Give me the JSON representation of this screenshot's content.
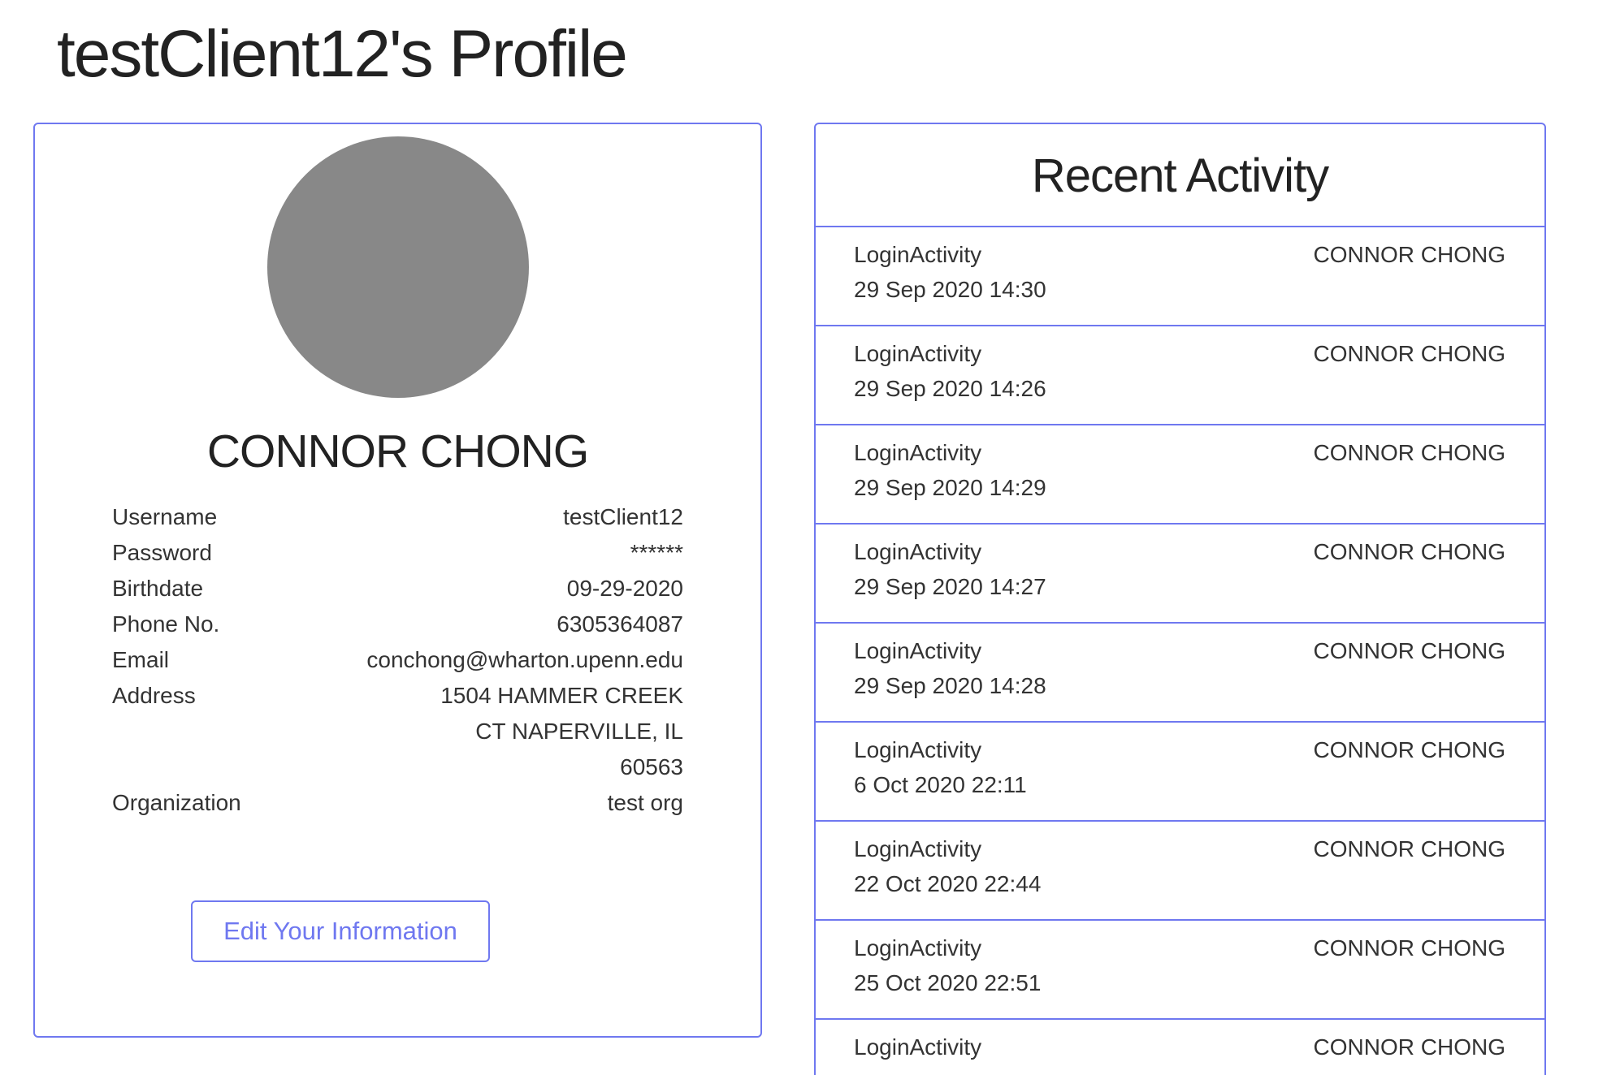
{
  "page": {
    "title": "testClient12's Profile"
  },
  "profile": {
    "name": "CONNOR CHONG",
    "fields": [
      {
        "label": "Username",
        "value": "testClient12"
      },
      {
        "label": "Password",
        "value": "******"
      },
      {
        "label": "Birthdate",
        "value": "09-29-2020"
      },
      {
        "label": "Phone No.",
        "value": "6305364087"
      },
      {
        "label": "Email",
        "value": "conchong@wharton.upenn.edu"
      },
      {
        "label": "Address",
        "value": "1504 HAMMER CREEK CT NAPERVILLE, IL 60563"
      },
      {
        "label": "Organization",
        "value": "test org"
      }
    ],
    "edit_button_label": "Edit Your Information"
  },
  "activity": {
    "title": "Recent Activity",
    "items": [
      {
        "type": "LoginActivity",
        "time": "29 Sep 2020 14:30",
        "user": "CONNOR CHONG"
      },
      {
        "type": "LoginActivity",
        "time": "29 Sep 2020 14:26",
        "user": "CONNOR CHONG"
      },
      {
        "type": "LoginActivity",
        "time": "29 Sep 2020 14:29",
        "user": "CONNOR CHONG"
      },
      {
        "type": "LoginActivity",
        "time": "29 Sep 2020 14:27",
        "user": "CONNOR CHONG"
      },
      {
        "type": "LoginActivity",
        "time": "29 Sep 2020 14:28",
        "user": "CONNOR CHONG"
      },
      {
        "type": "LoginActivity",
        "time": "6 Oct 2020 22:11",
        "user": "CONNOR CHONG"
      },
      {
        "type": "LoginActivity",
        "time": "22 Oct 2020 22:44",
        "user": "CONNOR CHONG"
      },
      {
        "type": "LoginActivity",
        "time": "25 Oct 2020 22:51",
        "user": "CONNOR CHONG"
      },
      {
        "type": "LoginActivity",
        "time": "",
        "user": "CONNOR CHONG"
      }
    ]
  },
  "colors": {
    "accent": "#6f78f0",
    "avatar": "#888888"
  }
}
